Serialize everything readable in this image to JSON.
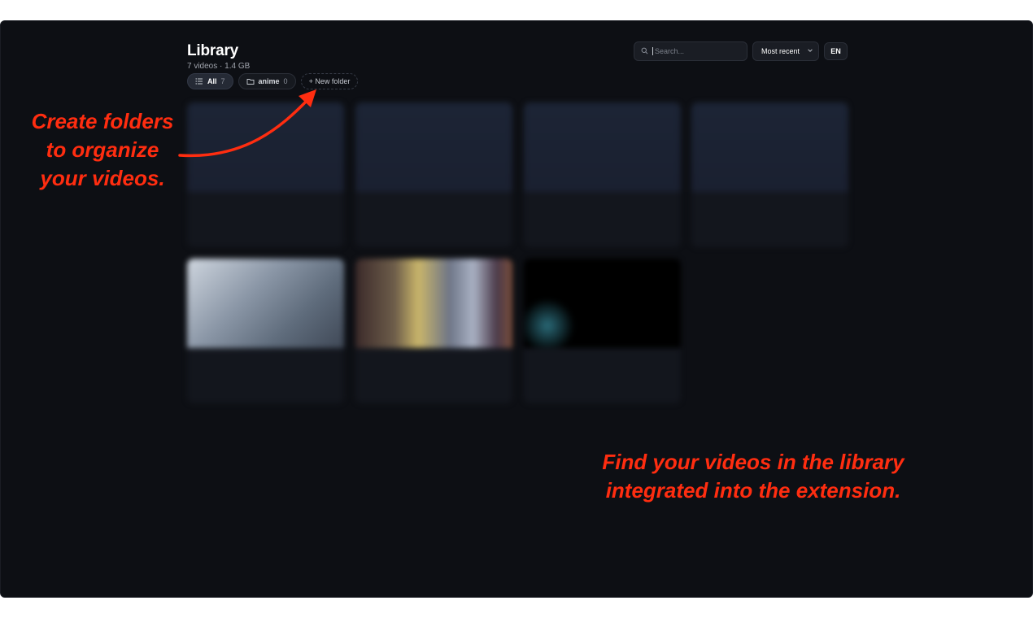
{
  "header": {
    "title": "Library",
    "subtitle": "7 videos · 1.4 GB"
  },
  "folders": [
    {
      "label": "All",
      "count": "7",
      "icon": "list-icon",
      "active": true
    },
    {
      "label": "anime",
      "count": "0",
      "icon": "folder-icon",
      "active": false
    }
  ],
  "new_folder_label": "+ New folder",
  "search": {
    "placeholder": "Search..."
  },
  "sort": {
    "value": "Most recent"
  },
  "language": "EN",
  "videos": [
    {
      "title": "",
      "meta": ""
    },
    {
      "title": "",
      "meta": ""
    },
    {
      "title": "",
      "meta": ""
    },
    {
      "title": "",
      "meta": ""
    },
    {
      "title": "",
      "meta": ""
    },
    {
      "title": "",
      "meta": ""
    },
    {
      "title": "",
      "meta": ""
    }
  ],
  "annotations": {
    "folders": "Create folders\nto organize\nyour videos.",
    "library": "Find your videos in the library\nintegrated into the extension."
  },
  "colors": {
    "background": "#0d0f14",
    "annotation": "#ff2d10",
    "card": "#13161d"
  }
}
